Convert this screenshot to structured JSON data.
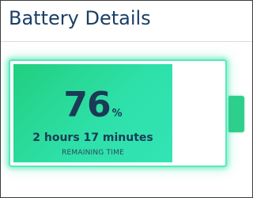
{
  "header": {
    "title": "Battery Details"
  },
  "battery": {
    "level_percent": 76,
    "level_text": "76",
    "unit": "%",
    "remaining_time": "2 hours 17 minutes",
    "remaining_caption": "REMAINING TIME",
    "fill_color": "#2ee0a8",
    "glow_color": "#58e9ba",
    "terminal_color": "#2ecf8c"
  },
  "colors": {
    "title": "#1b3f66",
    "text": "#1b3a55"
  }
}
